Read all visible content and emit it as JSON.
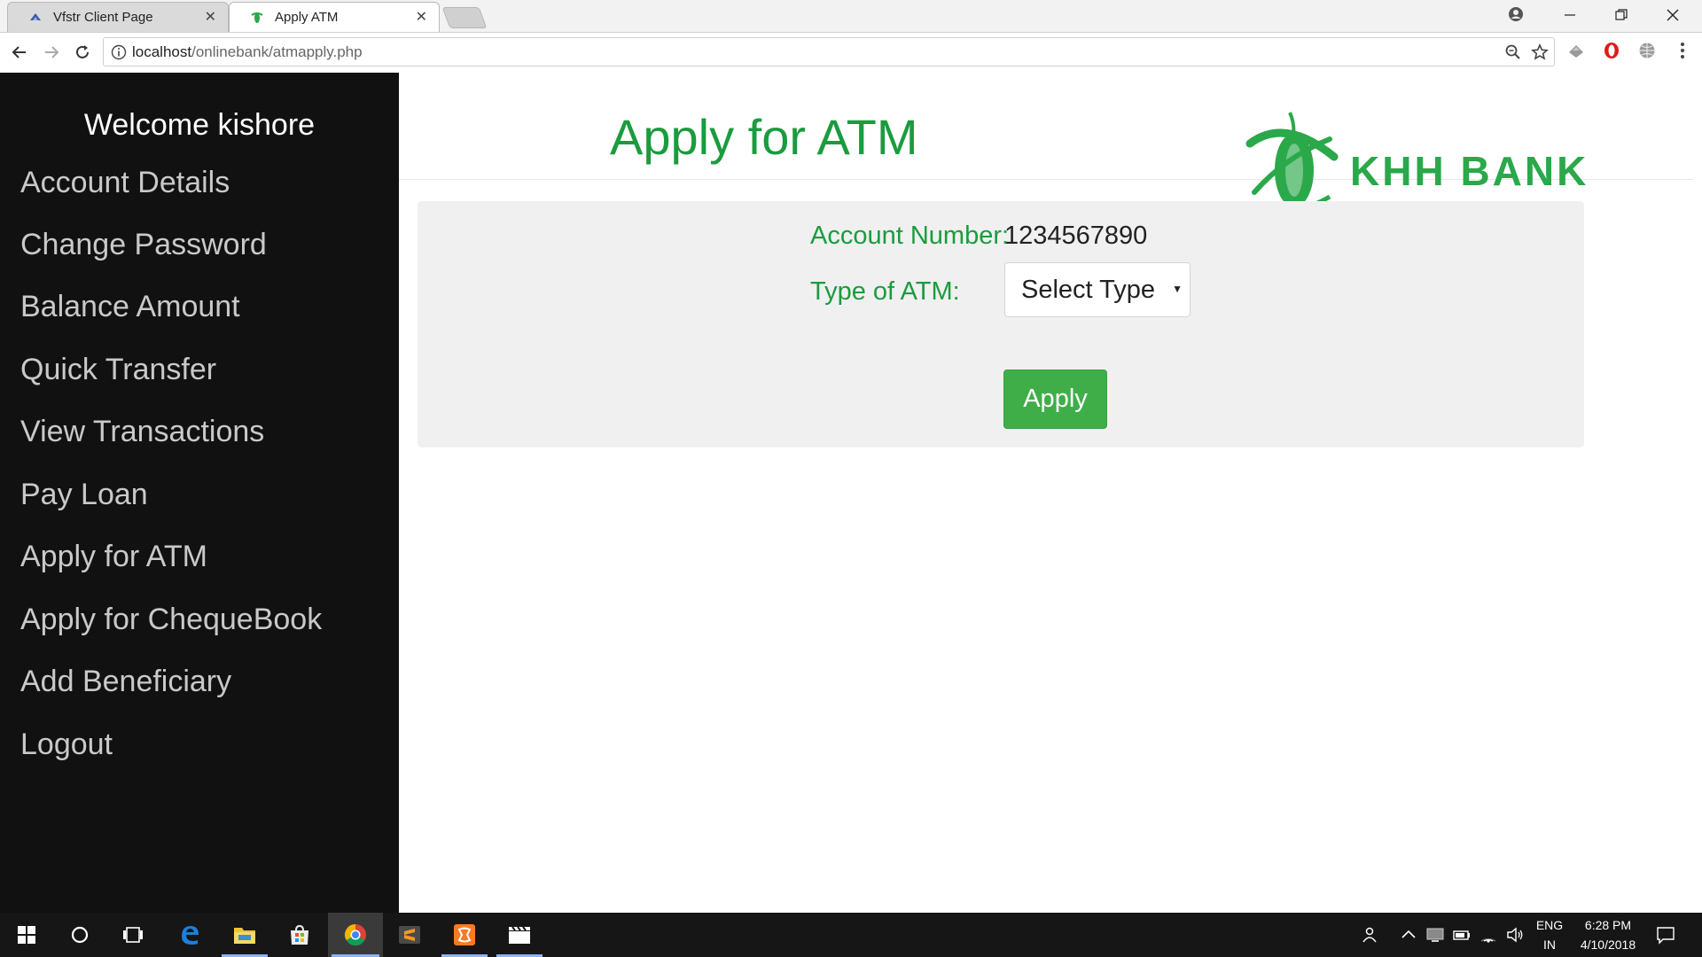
{
  "browser": {
    "tabs": [
      {
        "title": "Vfstr Client Page",
        "active": false
      },
      {
        "title": "Apply ATM",
        "active": true
      }
    ],
    "url_host": "localhost",
    "url_path": "/onlinebank/atmapply.php"
  },
  "sidebar": {
    "welcome": "Welcome kishore",
    "items": [
      {
        "label": "Account Details"
      },
      {
        "label": "Change Password"
      },
      {
        "label": "Balance Amount"
      },
      {
        "label": "Quick Transfer"
      },
      {
        "label": "View Transactions"
      },
      {
        "label": "Pay Loan"
      },
      {
        "label": "Apply for ATM"
      },
      {
        "label": "Apply for ChequeBook"
      },
      {
        "label": "Add Beneficiary"
      },
      {
        "label": "Logout"
      }
    ]
  },
  "main": {
    "title": "Apply for ATM",
    "logo_text": "KHH BANK",
    "form": {
      "account_label": "Account Number:",
      "account_value": "1234567890",
      "atm_type_label": "Type of ATM:",
      "atm_type_selected": "Select Type",
      "apply_label": "Apply"
    }
  },
  "taskbar": {
    "language": "ENG",
    "region": "IN",
    "time": "6:28 PM",
    "date": "4/10/2018"
  },
  "colors": {
    "accent_green": "#1a9c3e",
    "button_green": "#3fae49",
    "sidebar_bg": "#111111",
    "panel_bg": "#f0f0f0"
  }
}
